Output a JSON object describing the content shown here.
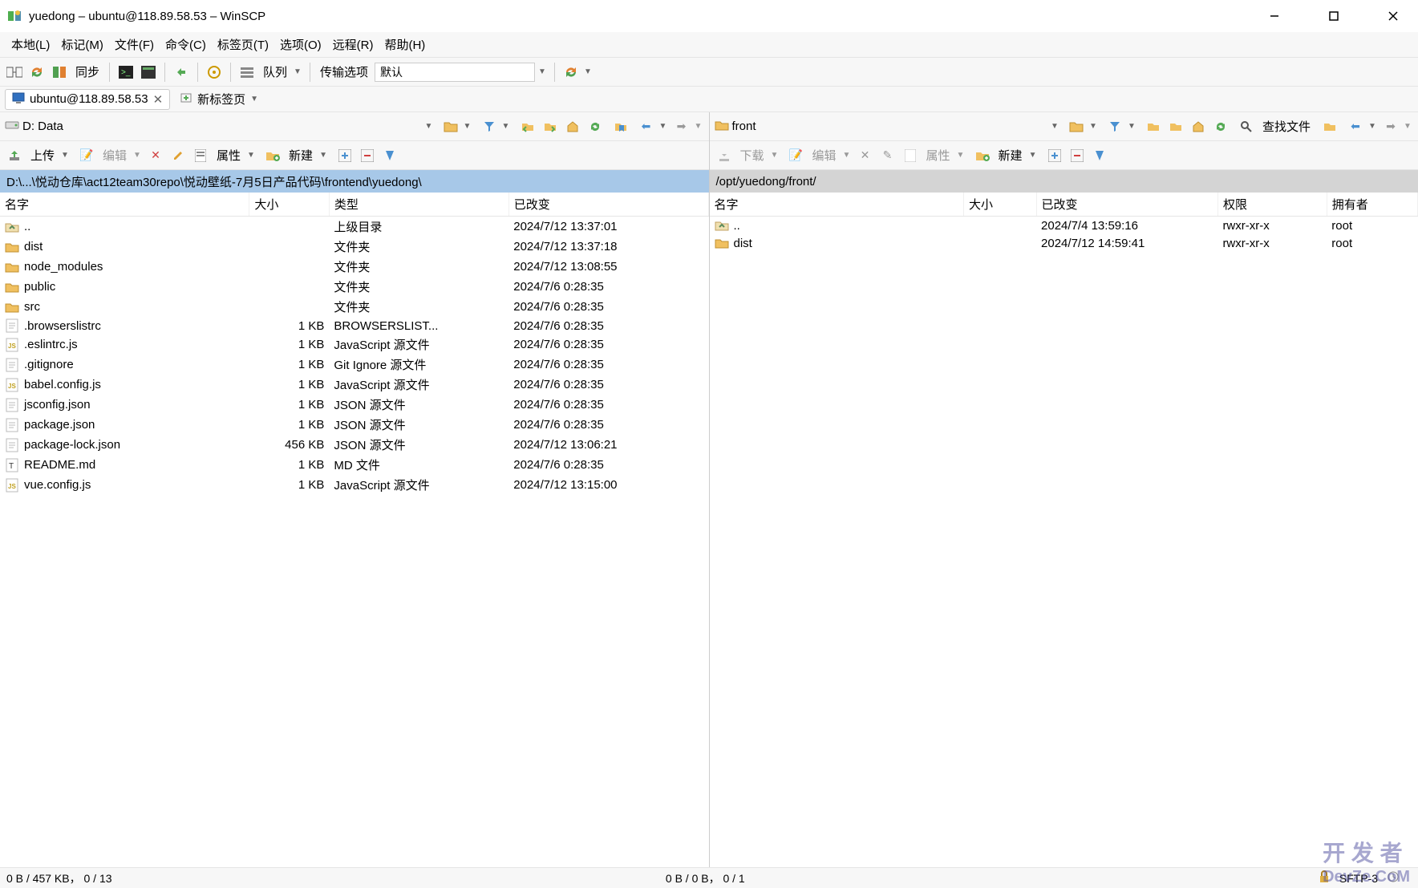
{
  "window": {
    "title": "yuedong – ubuntu@118.89.58.53 – WinSCP"
  },
  "menubar": [
    "本地(L)",
    "标记(M)",
    "文件(F)",
    "命令(C)",
    "标签页(T)",
    "选项(O)",
    "远程(R)",
    "帮助(H)"
  ],
  "toolbar": {
    "sync_label": "同步",
    "queue_label": "队列",
    "transfer_options_label": "传输选项",
    "transfer_preset": "默认"
  },
  "tabs": {
    "session": "ubuntu@118.89.58.53",
    "new_tab": "新标签页"
  },
  "left": {
    "drive": "D: Data",
    "upload_label": "上传",
    "edit_label": "编辑",
    "properties_label": "属性",
    "new_label": "新建",
    "path": "D:\\...\\悦动仓库\\act12team30repo\\悦动壁纸-7月5日产品代码\\frontend\\yuedong\\",
    "columns": [
      "名字",
      "大小",
      "类型",
      "已改变"
    ],
    "col_widths": [
      "250px",
      "80px",
      "180px",
      "200px"
    ],
    "rows": [
      {
        "icon": "updir",
        "name": "..",
        "size": "",
        "type": "上级目录",
        "changed": "2024/7/12 13:37:01"
      },
      {
        "icon": "folder",
        "name": "dist",
        "size": "",
        "type": "文件夹",
        "changed": "2024/7/12 13:37:18",
        "selected": true
      },
      {
        "icon": "folder",
        "name": "node_modules",
        "size": "",
        "type": "文件夹",
        "changed": "2024/7/12 13:08:55"
      },
      {
        "icon": "folder",
        "name": "public",
        "size": "",
        "type": "文件夹",
        "changed": "2024/7/6 0:28:35"
      },
      {
        "icon": "folder",
        "name": "src",
        "size": "",
        "type": "文件夹",
        "changed": "2024/7/6 0:28:35"
      },
      {
        "icon": "file",
        "name": ".browserslistrc",
        "size": "1 KB",
        "type": "BROWSERSLIST...",
        "changed": "2024/7/6 0:28:35"
      },
      {
        "icon": "js",
        "name": ".eslintrc.js",
        "size": "1 KB",
        "type": "JavaScript 源文件",
        "changed": "2024/7/6 0:28:35"
      },
      {
        "icon": "file",
        "name": ".gitignore",
        "size": "1 KB",
        "type": "Git Ignore 源文件",
        "changed": "2024/7/6 0:28:35"
      },
      {
        "icon": "js",
        "name": "babel.config.js",
        "size": "1 KB",
        "type": "JavaScript 源文件",
        "changed": "2024/7/6 0:28:35"
      },
      {
        "icon": "file",
        "name": "jsconfig.json",
        "size": "1 KB",
        "type": "JSON 源文件",
        "changed": "2024/7/6 0:28:35"
      },
      {
        "icon": "file",
        "name": "package.json",
        "size": "1 KB",
        "type": "JSON 源文件",
        "changed": "2024/7/6 0:28:35"
      },
      {
        "icon": "file",
        "name": "package-lock.json",
        "size": "456 KB",
        "type": "JSON 源文件",
        "changed": "2024/7/12 13:06:21"
      },
      {
        "icon": "text",
        "name": "README.md",
        "size": "1 KB",
        "type": "MD 文件",
        "changed": "2024/7/6 0:28:35"
      },
      {
        "icon": "js",
        "name": "vue.config.js",
        "size": "1 KB",
        "type": "JavaScript 源文件",
        "changed": "2024/7/12 13:15:00"
      }
    ],
    "status": "0 B / 457 KB， 0 / 13"
  },
  "right": {
    "drive": "front",
    "download_label": "下载",
    "edit_label": "编辑",
    "properties_label": "属性",
    "new_label": "新建",
    "find_label": "查找文件",
    "path": "/opt/yuedong/front/",
    "columns": [
      "名字",
      "大小",
      "已改变",
      "权限",
      "拥有者"
    ],
    "col_widths": [
      "280px",
      "80px",
      "200px",
      "120px",
      "100px"
    ],
    "rows": [
      {
        "icon": "updir",
        "name": "..",
        "size": "",
        "changed": "2024/7/4 13:59:16",
        "rights": "rwxr-xr-x",
        "owner": "root"
      },
      {
        "icon": "folder",
        "name": "dist",
        "size": "",
        "changed": "2024/7/12 14:59:41",
        "rights": "rwxr-xr-x",
        "owner": "root"
      }
    ],
    "status": "0 B / 0 B， 0 / 1"
  },
  "statusbar": {
    "protocol": "SFTP-3"
  },
  "watermark": {
    "line1": "开 发 者",
    "line2": "DevZe.CoM"
  }
}
